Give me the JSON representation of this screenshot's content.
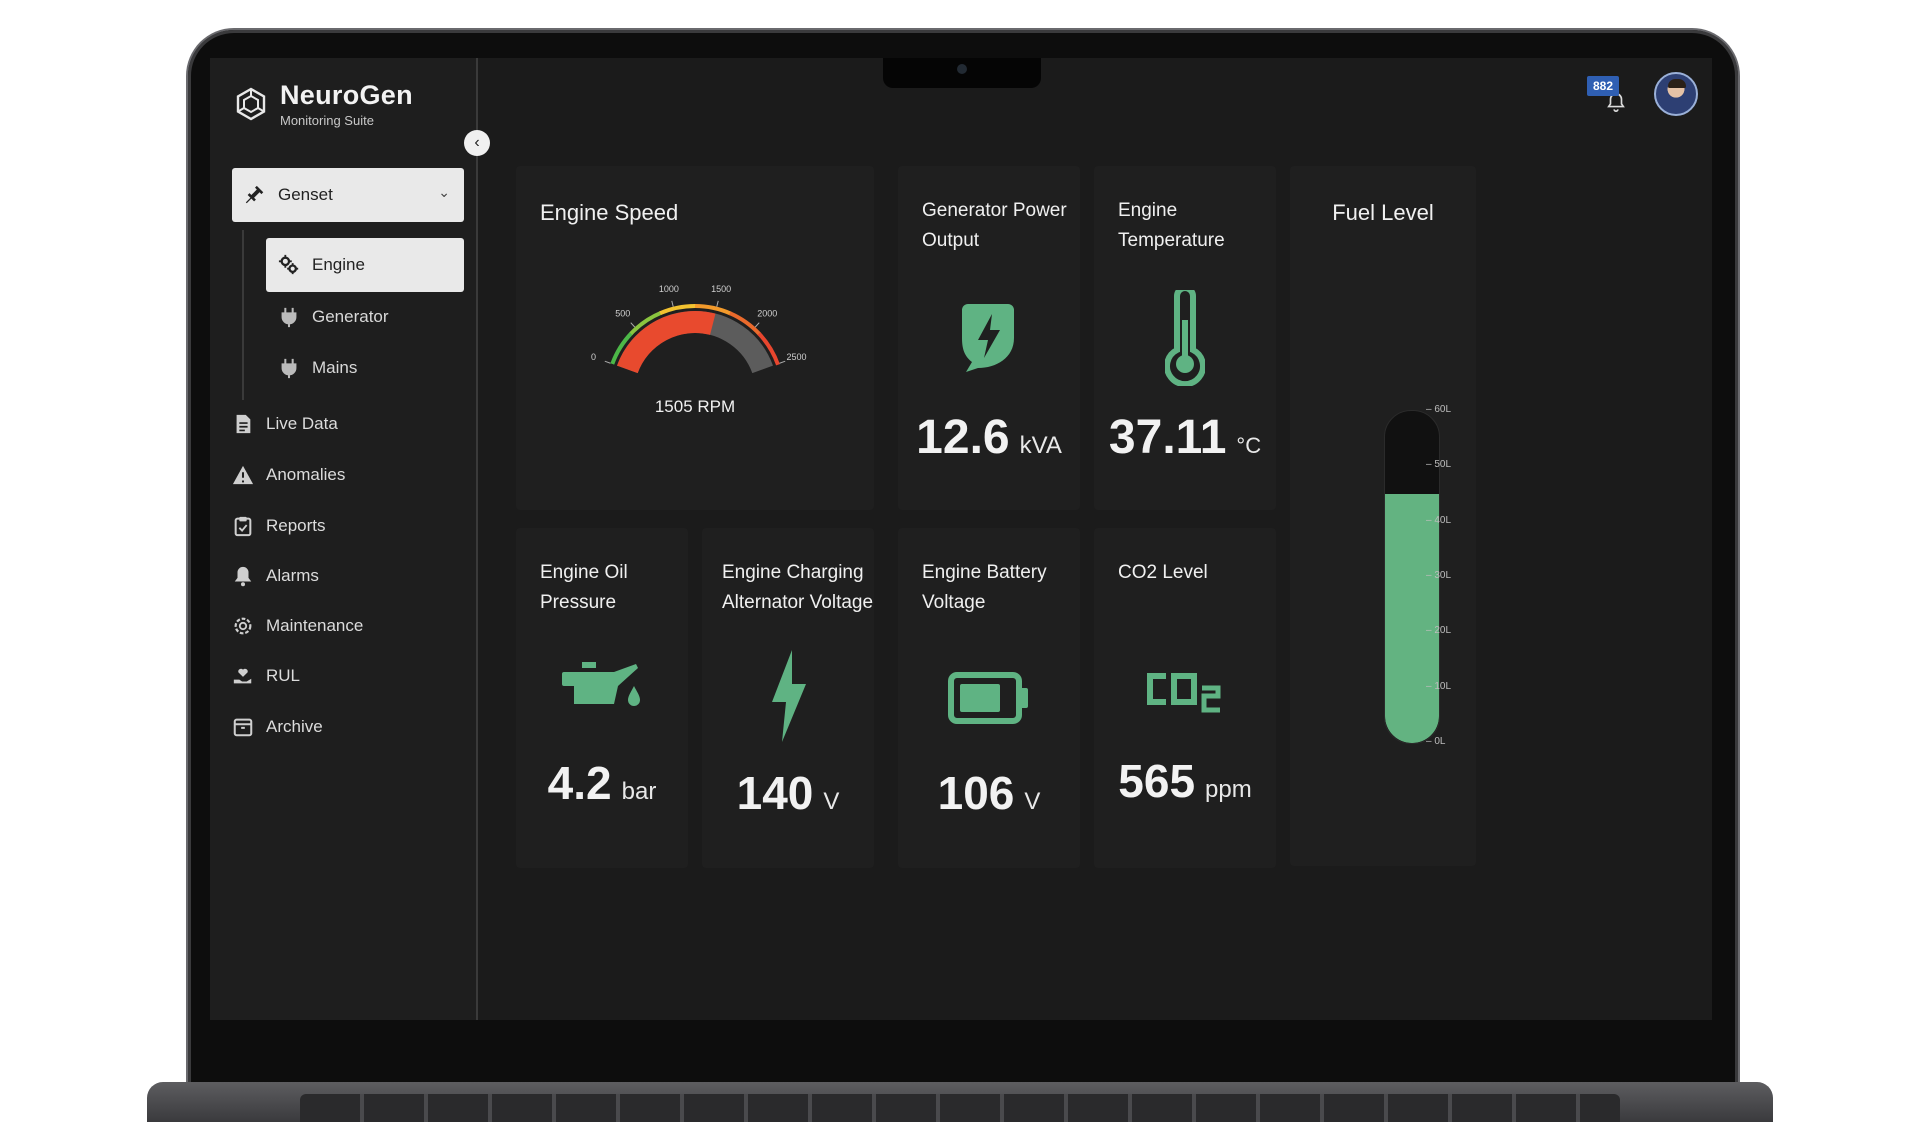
{
  "brand": {
    "name": "NeuroGen",
    "subtitle": "Monitoring Suite"
  },
  "sidebar": {
    "group": {
      "label": "Genset",
      "icon": "plug-icon",
      "expanded": true
    },
    "sub_items": [
      {
        "label": "Engine",
        "icon": "gears-icon",
        "active": true
      },
      {
        "label": "Generator",
        "icon": "plug-icon",
        "active": false
      },
      {
        "label": "Mains",
        "icon": "plug-icon",
        "active": false
      }
    ],
    "items": [
      {
        "label": "Live Data",
        "icon": "document-icon"
      },
      {
        "label": "Anomalies",
        "icon": "warning-icon"
      },
      {
        "label": "Reports",
        "icon": "clipboard-icon"
      },
      {
        "label": "Alarms",
        "icon": "bell-icon"
      },
      {
        "label": "Maintenance",
        "icon": "wrench-gear-icon"
      },
      {
        "label": "RUL",
        "icon": "heart-hand-icon"
      },
      {
        "label": "Archive",
        "icon": "archive-icon"
      }
    ]
  },
  "topbar": {
    "notification_count": "882"
  },
  "colors": {
    "accent_green": "#5fb383",
    "gauge_red": "#e84a2e",
    "background": "#1b1b1b",
    "card": "#1f1f1f"
  },
  "cards": {
    "engine_speed": {
      "title": "Engine Speed",
      "readout": "1505 RPM",
      "value": 1505,
      "min": 0,
      "max": 2500,
      "ticks": [
        "0",
        "500",
        "1000",
        "1500",
        "2000",
        "2500"
      ]
    },
    "generator_power": {
      "title": "Generator Power Output",
      "value": "12.6",
      "unit": "kVA",
      "icon": "leaf-bolt-icon"
    },
    "engine_temperature": {
      "title": "Engine Temperature",
      "value": "37.11",
      "unit": "°C",
      "icon": "thermometer-icon"
    },
    "fuel_level": {
      "title": "Fuel Level",
      "level_liters": 45,
      "max_liters": 60,
      "ticks": [
        "60L",
        "50L",
        "40L",
        "30L",
        "20L",
        "10L",
        "0L"
      ]
    },
    "oil_pressure": {
      "title": "Engine Oil Pressure",
      "value": "4.2",
      "unit": "bar",
      "icon": "oil-can-icon"
    },
    "charging_voltage": {
      "title": "Engine Charging Alternator Voltage",
      "value": "140",
      "unit": "V",
      "icon": "lightning-icon"
    },
    "battery_voltage": {
      "title": "Engine Battery Voltage",
      "value": "106",
      "unit": "V",
      "icon": "battery-icon"
    },
    "co2_level": {
      "title": "CO2 Level",
      "value": "565",
      "unit": "ppm",
      "icon": "co2-icon"
    }
  }
}
